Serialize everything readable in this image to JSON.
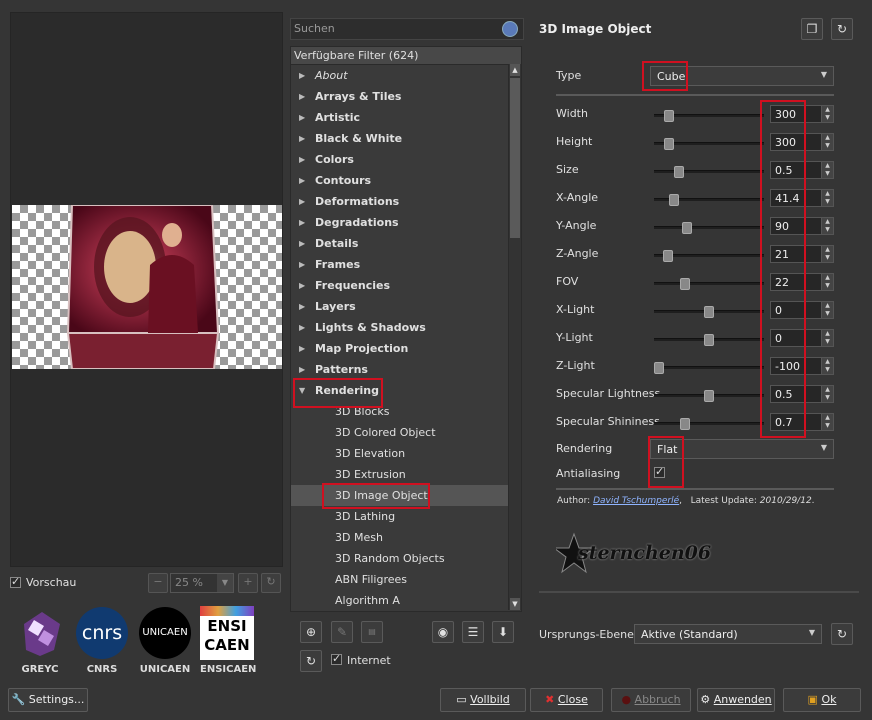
{
  "preview": {
    "checkbox_label": "Vorschau",
    "zoom": "25 %"
  },
  "logos": [
    "GREYC",
    "CNRS",
    "UNICAEN",
    "ENSICAEN"
  ],
  "logo_text": {
    "cnrs": "cnrs",
    "unicaen": "UNICAEN",
    "ensi1": "ENSI",
    "ensi2": "CAEN"
  },
  "settings_label": "Settings...",
  "search_placeholder": "Suchen",
  "tree_header": "Verfügbare Filter (624)",
  "categories": [
    "About",
    "Arrays & Tiles",
    "Artistic",
    "Black & White",
    "Colors",
    "Contours",
    "Deformations",
    "Degradations",
    "Details",
    "Frames",
    "Frequencies",
    "Layers",
    "Lights & Shadows",
    "Map Projection",
    "Patterns",
    "Rendering"
  ],
  "subitems": [
    "3D Blocks",
    "3D Colored Object",
    "3D Elevation",
    "3D Extrusion",
    "3D Image Object",
    "3D Lathing",
    "3D Mesh",
    "3D Random Objects",
    "ABN Filigrees",
    "Algorithm A"
  ],
  "internet_label": "Internet",
  "filter_title": "3D Image Object",
  "type": {
    "label": "Type",
    "value": "Cube"
  },
  "params": [
    {
      "label": "Width",
      "value": "300",
      "level": 0.1
    },
    {
      "label": "Height",
      "value": "300",
      "level": 0.1
    },
    {
      "label": "Size",
      "value": "0.5",
      "level": 0.2
    },
    {
      "label": "X-Angle",
      "value": "41.4",
      "level": 0.15
    },
    {
      "label": "Y-Angle",
      "value": "90",
      "level": 0.28
    },
    {
      "label": "Z-Angle",
      "value": "21",
      "level": 0.09
    },
    {
      "label": "FOV",
      "value": "22",
      "level": 0.26
    },
    {
      "label": "X-Light",
      "value": "0",
      "level": 0.5
    },
    {
      "label": "Y-Light",
      "value": "0",
      "level": 0.5
    },
    {
      "label": "Z-Light",
      "value": "-100",
      "level": 0
    },
    {
      "label": "Specular Lightness",
      "value": "0.5",
      "level": 0.5
    },
    {
      "label": "Specular Shininess",
      "value": "0.7",
      "level": 0.26
    }
  ],
  "rendering": {
    "label": "Rendering",
    "value": "Flat"
  },
  "antialiasing_label": "Antialiasing",
  "author_prefix": "Author:",
  "author_name": "David Tschumperlé",
  "update_prefix": "Latest Update:",
  "update_date": "2010/29/12",
  "signature": "sternchen06",
  "input_layers": {
    "label": "Ursprungs-Ebenen",
    "value": "Aktive (Standard)"
  },
  "buttons": {
    "fullscreen": "Vollbild",
    "close": "Close",
    "cancel": "Abbruch",
    "apply": "Anwenden",
    "ok": "Ok"
  },
  "colors": {
    "highlight": "#d01020",
    "link": "#8fb4ff"
  }
}
